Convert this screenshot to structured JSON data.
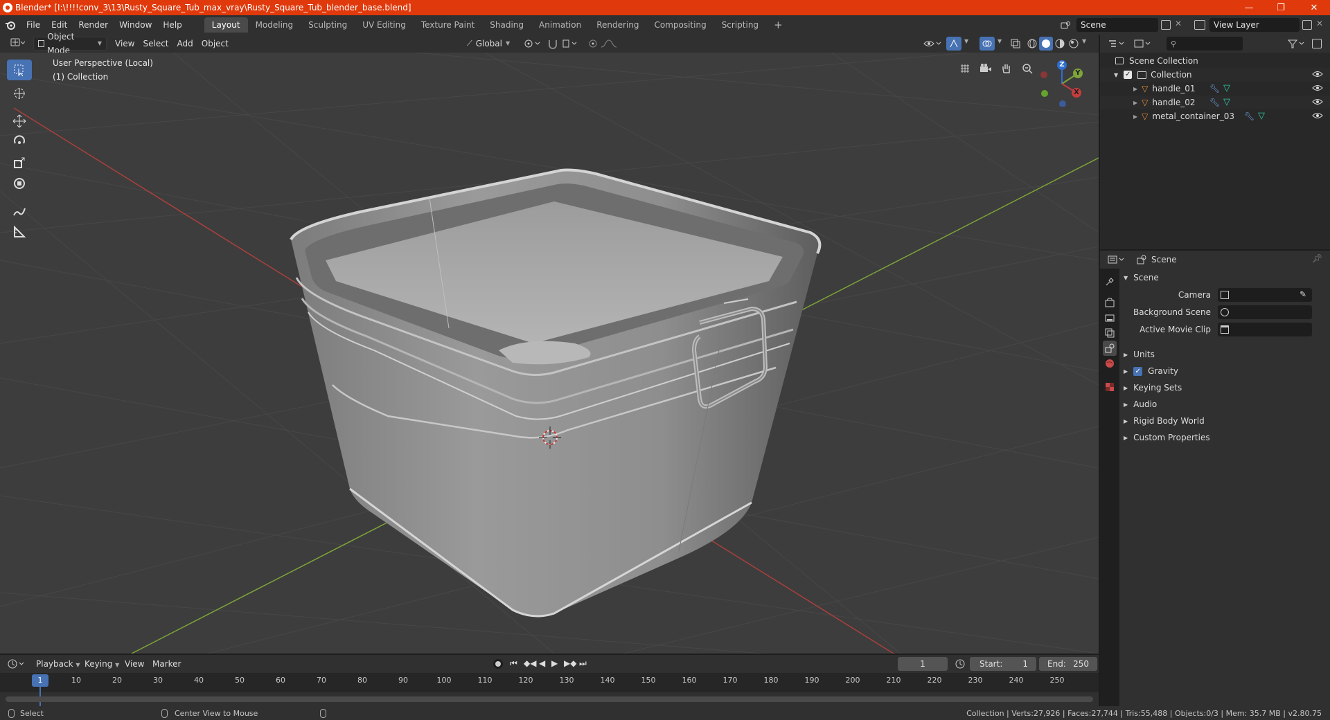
{
  "window": {
    "title": "Blender* [I:\\!!!!conv_3\\13\\Rusty_Square_Tub_max_vray\\Rusty_Square_Tub_blender_base.blend]",
    "minimize": "—",
    "maximize": "❐",
    "close": "✕"
  },
  "menubar": {
    "menus": [
      "File",
      "Edit",
      "Render",
      "Window",
      "Help"
    ],
    "workspaces": [
      "Layout",
      "Modeling",
      "Sculpting",
      "UV Editing",
      "Texture Paint",
      "Shading",
      "Animation",
      "Rendering",
      "Compositing",
      "Scripting"
    ],
    "active_workspace": "Layout",
    "add_workspace": "+",
    "scene": "Scene",
    "view_layer": "View Layer"
  },
  "viewport_header": {
    "mode": "Object Mode",
    "menus": [
      "View",
      "Select",
      "Add",
      "Object"
    ],
    "transform_orientation": "Global"
  },
  "viewport": {
    "perspective_label": "User Perspective (Local)",
    "collection_label": "(1) Collection",
    "gizmo": {
      "z": "Z",
      "y": "Y",
      "x": "X"
    },
    "colors": {
      "x_axis": "#b0403c",
      "y_axis": "#7ea53a",
      "background": "#3d3d3d",
      "grid": "#454545",
      "accent": "#4772b3"
    }
  },
  "outliner": {
    "root": "Scene Collection",
    "collection": "Collection",
    "items": [
      {
        "name": "handle_01"
      },
      {
        "name": "handle_02"
      },
      {
        "name": "metal_container_03"
      }
    ]
  },
  "properties": {
    "context": "Scene",
    "panel_title": "Scene",
    "fields": [
      {
        "label": "Camera"
      },
      {
        "label": "Background Scene"
      },
      {
        "label": "Active Movie Clip"
      }
    ],
    "sections": [
      "Units",
      "Gravity",
      "Keying Sets",
      "Audio",
      "Rigid Body World",
      "Custom Properties"
    ],
    "gravity_checked": true
  },
  "timeline": {
    "menus": [
      "Playback",
      "Keying",
      "View",
      "Marker"
    ],
    "current_frame": "1",
    "start_label": "Start:",
    "start": "1",
    "end_label": "End:",
    "end": "250",
    "ruler_ticks": [
      "1",
      "10",
      "20",
      "30",
      "40",
      "50",
      "60",
      "70",
      "80",
      "90",
      "100",
      "110",
      "120",
      "130",
      "140",
      "150",
      "160",
      "170",
      "180",
      "190",
      "200",
      "210",
      "220",
      "230",
      "240",
      "250"
    ]
  },
  "statusbar": {
    "left_action": "Select",
    "middle_action": "Center View to Mouse",
    "stats": "Collection | Verts:27,926 | Faces:27,744 | Tris:55,488 | Objects:0/3 | Mem: 35.7 MB | v2.80.75"
  }
}
